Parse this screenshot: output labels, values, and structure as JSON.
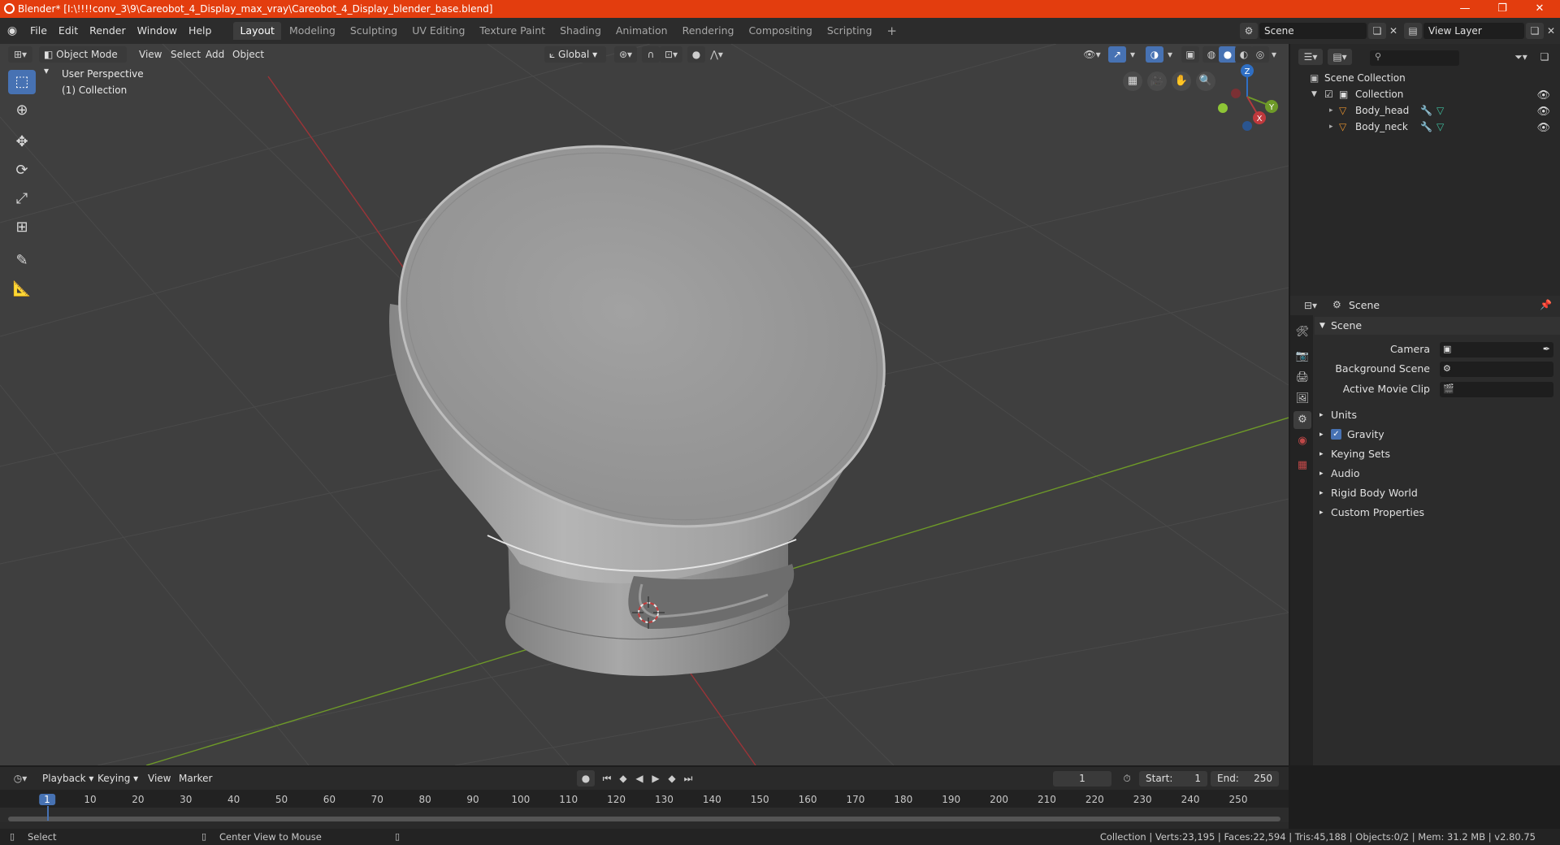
{
  "window": {
    "title": "Blender* [I:\\!!!!conv_3\\9\\Careobot_4_Display_max_vray\\Careobot_4_Display_blender_base.blend]",
    "minimize": "—",
    "maximize": "❐",
    "close": "✕"
  },
  "menubar": {
    "items": [
      "File",
      "Edit",
      "Render",
      "Window",
      "Help"
    ],
    "workspaces": [
      "Layout",
      "Modeling",
      "Sculpting",
      "UV Editing",
      "Texture Paint",
      "Shading",
      "Animation",
      "Rendering",
      "Compositing",
      "Scripting"
    ],
    "active_workspace": "Layout",
    "add_tab": "+",
    "scene_name": "Scene",
    "view_layer_name": "View Layer"
  },
  "viewport": {
    "mode": "Object Mode",
    "menus": [
      "View",
      "Select",
      "Add",
      "Object"
    ],
    "orientation": "Global",
    "overlay_title": "User Perspective",
    "overlay_collection": "(1) Collection",
    "gizmo": {
      "x": "X",
      "y": "Y",
      "z": "Z"
    },
    "colors": {
      "background": "#3f3f3f",
      "grid": "#4a4a4a",
      "x_axis": "#b0383c",
      "y_axis": "#6e9a28",
      "active": "#4772b3"
    }
  },
  "outliner": {
    "search_placeholder": "",
    "root": "Scene Collection",
    "collection": "Collection",
    "objects": [
      "Body_head",
      "Body_neck"
    ]
  },
  "properties": {
    "header": "Scene",
    "panel_title": "Scene",
    "camera_label": "Camera",
    "background_scene_label": "Background Scene",
    "active_movie_clip_label": "Active Movie Clip",
    "sections": [
      "Units",
      "Gravity",
      "Keying Sets",
      "Audio",
      "Rigid Body World",
      "Custom Properties"
    ],
    "gravity_checked": true
  },
  "timeline": {
    "menus": [
      "Playback",
      "Keying",
      "View",
      "Marker"
    ],
    "current_frame": "1",
    "start_label": "Start:",
    "start_value": "1",
    "end_label": "End:",
    "end_value": "250",
    "ticks": [
      "1",
      "10",
      "20",
      "30",
      "40",
      "50",
      "60",
      "70",
      "80",
      "90",
      "100",
      "110",
      "120",
      "130",
      "140",
      "150",
      "160",
      "170",
      "180",
      "190",
      "200",
      "210",
      "220",
      "230",
      "240",
      "250"
    ]
  },
  "statusbar": {
    "left_hint": "Select",
    "middle_hint": "Center View to Mouse",
    "stats": "Collection | Verts:23,195 | Faces:22,594 | Tris:45,188 | Objects:0/2 | Mem: 31.2 MB | v2.80.75"
  }
}
